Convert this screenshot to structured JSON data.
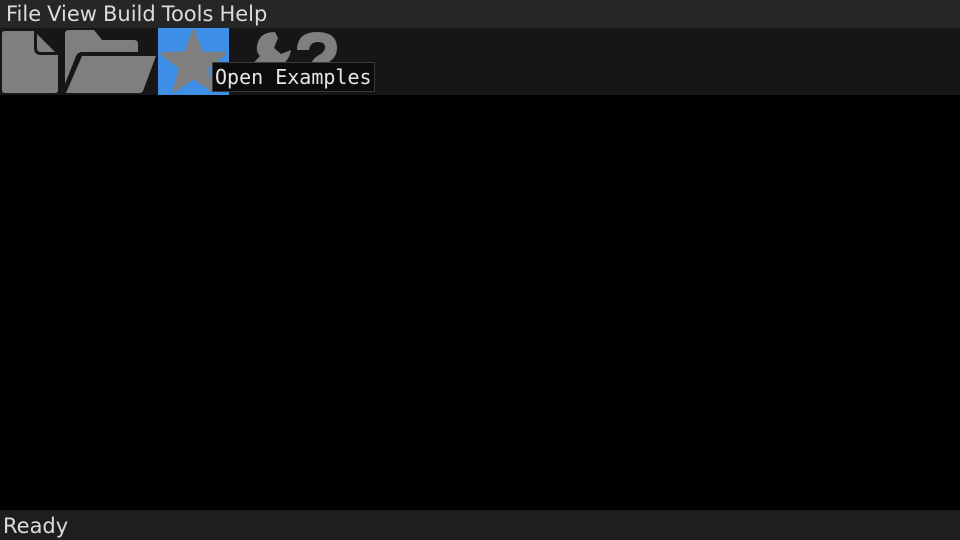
{
  "menu": {
    "items": [
      {
        "label": "File"
      },
      {
        "label": "View"
      },
      {
        "label": "Build"
      },
      {
        "label": "Tools"
      },
      {
        "label": "Help"
      }
    ]
  },
  "toolbar": {
    "buttons": [
      {
        "icon": "new-file-icon",
        "active": false
      },
      {
        "icon": "open-folder-icon",
        "active": false
      },
      {
        "icon": "star-icon",
        "active": true
      },
      {
        "icon": "help-tools-icon",
        "active": false
      }
    ],
    "tooltip": "Open Examples"
  },
  "status": {
    "text": "Ready"
  },
  "colors": {
    "accent": "#3d8fe8",
    "icon": "#7f7f7f",
    "menubar_bg": "#262626",
    "toolbar_bg": "#161616",
    "canvas_bg": "#000000"
  }
}
